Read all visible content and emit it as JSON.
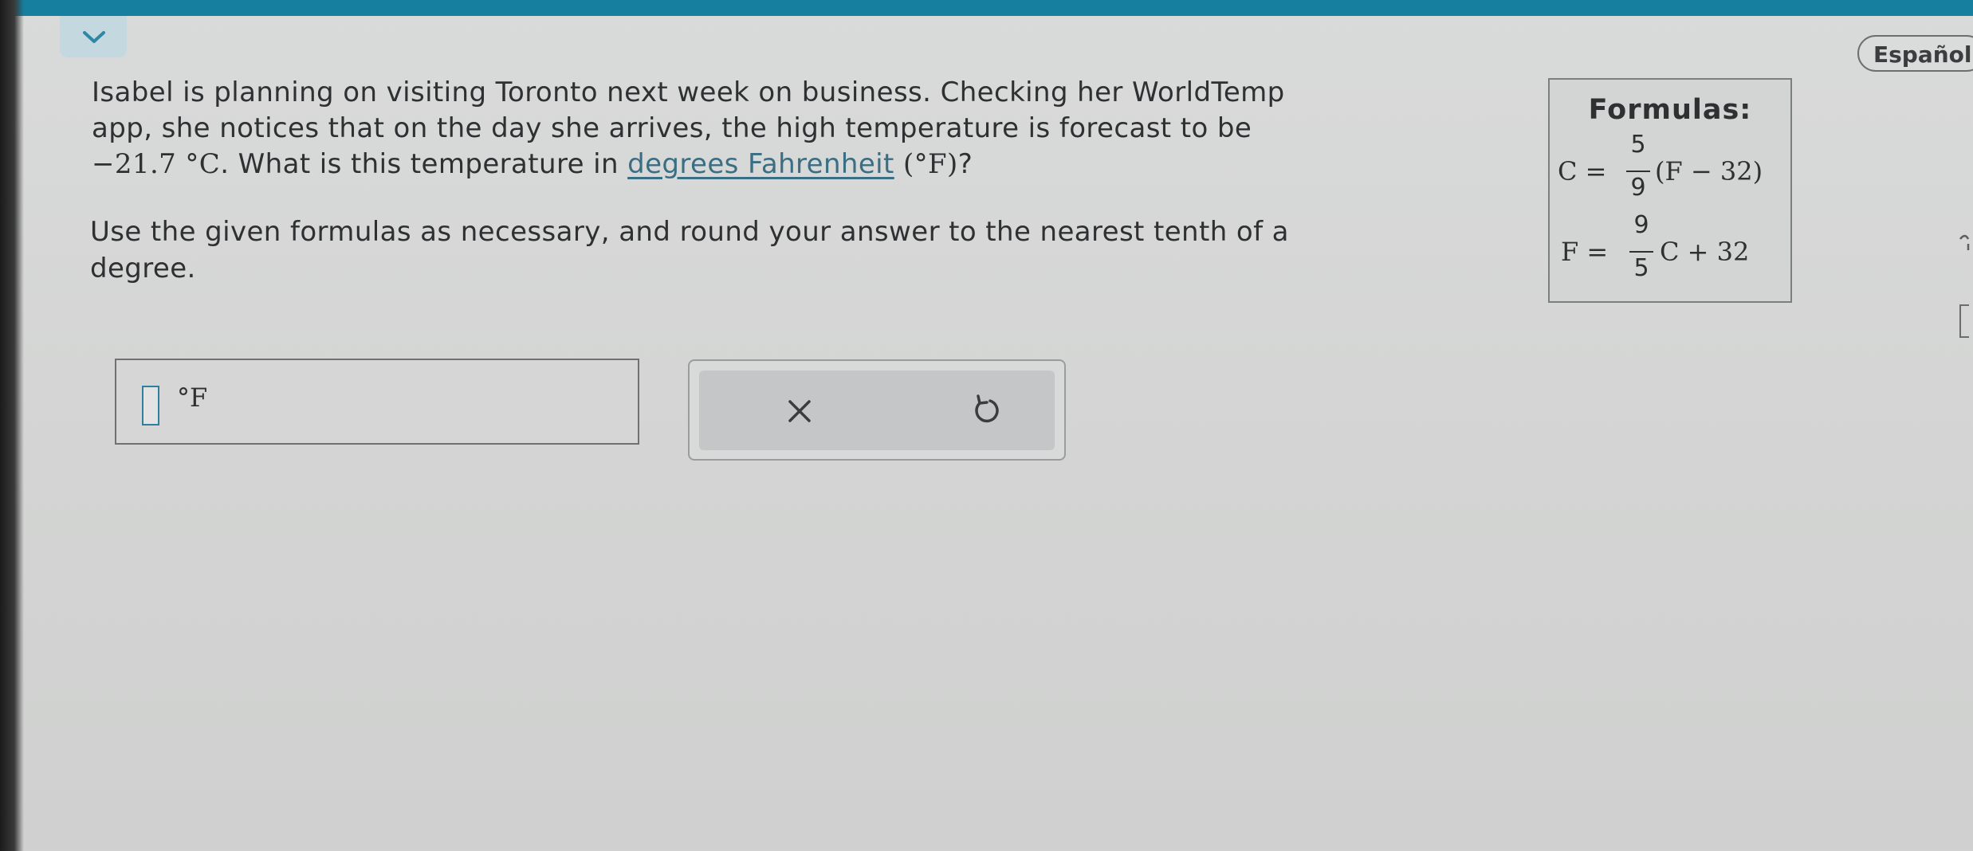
{
  "header": {
    "collapse_icon": "chevron-down-icon",
    "language_button": "Español"
  },
  "question": {
    "line1": "Isabel is planning on visiting Toronto next week on business. Checking her WorldTemp",
    "line2": "app, she notices that on the day she arrives, the high temperature is forecast to be",
    "temperature": "−21.7 °C",
    "line3_mid": ". What is this temperature in ",
    "term_link": "degrees Fahrenheit",
    "unit_paren": " (°F)",
    "line3_end": "?"
  },
  "instruction": {
    "line1": "Use the given formulas as necessary, and round your answer to the nearest tenth of a",
    "line2": "degree."
  },
  "formulas": {
    "title": "Formulas:",
    "f1": {
      "lhs": "C =",
      "num": "5",
      "den": "9",
      "rhs": "(F − 32)"
    },
    "f2": {
      "lhs": "F =",
      "num": "9",
      "den": "5",
      "rhs": "C + 32"
    }
  },
  "answer": {
    "value": "",
    "unit": "°F"
  },
  "actions": {
    "clear_icon": "close-icon",
    "undo_icon": "undo-icon"
  },
  "colors": {
    "top_bar": "#167fa0",
    "link": "#3a6e82",
    "input_border": "#2f7f9d"
  }
}
